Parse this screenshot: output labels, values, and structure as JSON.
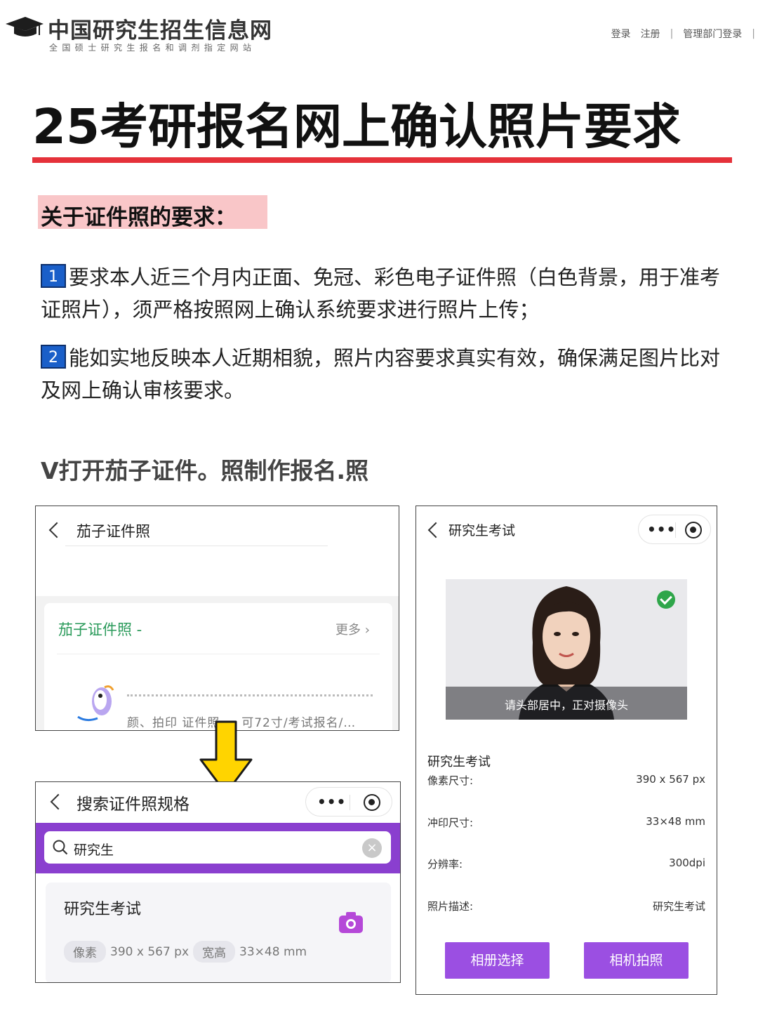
{
  "site": {
    "title": "中国研究生招生信息网",
    "subtitle": "全国硕士研究生报名和调剂指定网站",
    "links": {
      "login": "登录",
      "register": "注册",
      "admin_login": "管理部门登录",
      "separator": "|"
    }
  },
  "headline": "25考研报名网上确认照片要求",
  "section_label": "关于证件照的要求：",
  "requirements": [
    {
      "num": "1",
      "text": "要求本人近三个月内正面、免冠、彩色电子证件照（白色背景，用于准考证照片），须严格按照网上确认系统要求进行照片上传；"
    },
    {
      "num": "2",
      "text": "能如实地反映本人近期相貌，照片内容要求真实有效，确保满足图片比对及网上确认审核要求。"
    }
  ],
  "instruction": "V打开茄子证件。照制作报名.照",
  "screen_search_app": {
    "title": "茄子证件照",
    "card_title": "茄子证件照 -",
    "more": "更多",
    "cut_text": "颜、拍印  证件照  … 可72寸/考试报名/…"
  },
  "screen_spec_search": {
    "title": "搜索证件照规格",
    "search_value": "研究生",
    "clear": "×",
    "result_title": "研究生考试",
    "pixel_tag": "像素",
    "pixel_value": "390 x 567 px",
    "size_tag": "宽高",
    "size_value": "33×48 mm"
  },
  "screen_exam": {
    "title": "研究生考试",
    "photo_hint": "请头部居中，正对摄像头",
    "info_title": "研究生考试",
    "rows": [
      {
        "k": "像素尺寸:",
        "v": "390 x 567 px"
      },
      {
        "k": "冲印尺寸:",
        "v": "33×48 mm"
      },
      {
        "k": "分辨率:",
        "v": "300dpi"
      },
      {
        "k": "照片描述:",
        "v": "研究生考试"
      }
    ],
    "album_button": "相册选择",
    "camera_button": "相机拍照"
  },
  "colors": {
    "rule_red": "#e5313a",
    "label_pink": "#f9c6c8",
    "badge_blue": "#1a5fc9",
    "brand_purple": "#8a3fcf",
    "button_purple": "#9b4fe2",
    "app_green": "#2a9a5a",
    "arrow_yellow": "#ffd400"
  },
  "icons": [
    "graduation-cap-icon",
    "back-chevron-icon",
    "more-dots-icon",
    "target-icon",
    "search-icon",
    "clear-icon",
    "camera-icon",
    "check-icon",
    "arrow-down-icon"
  ]
}
